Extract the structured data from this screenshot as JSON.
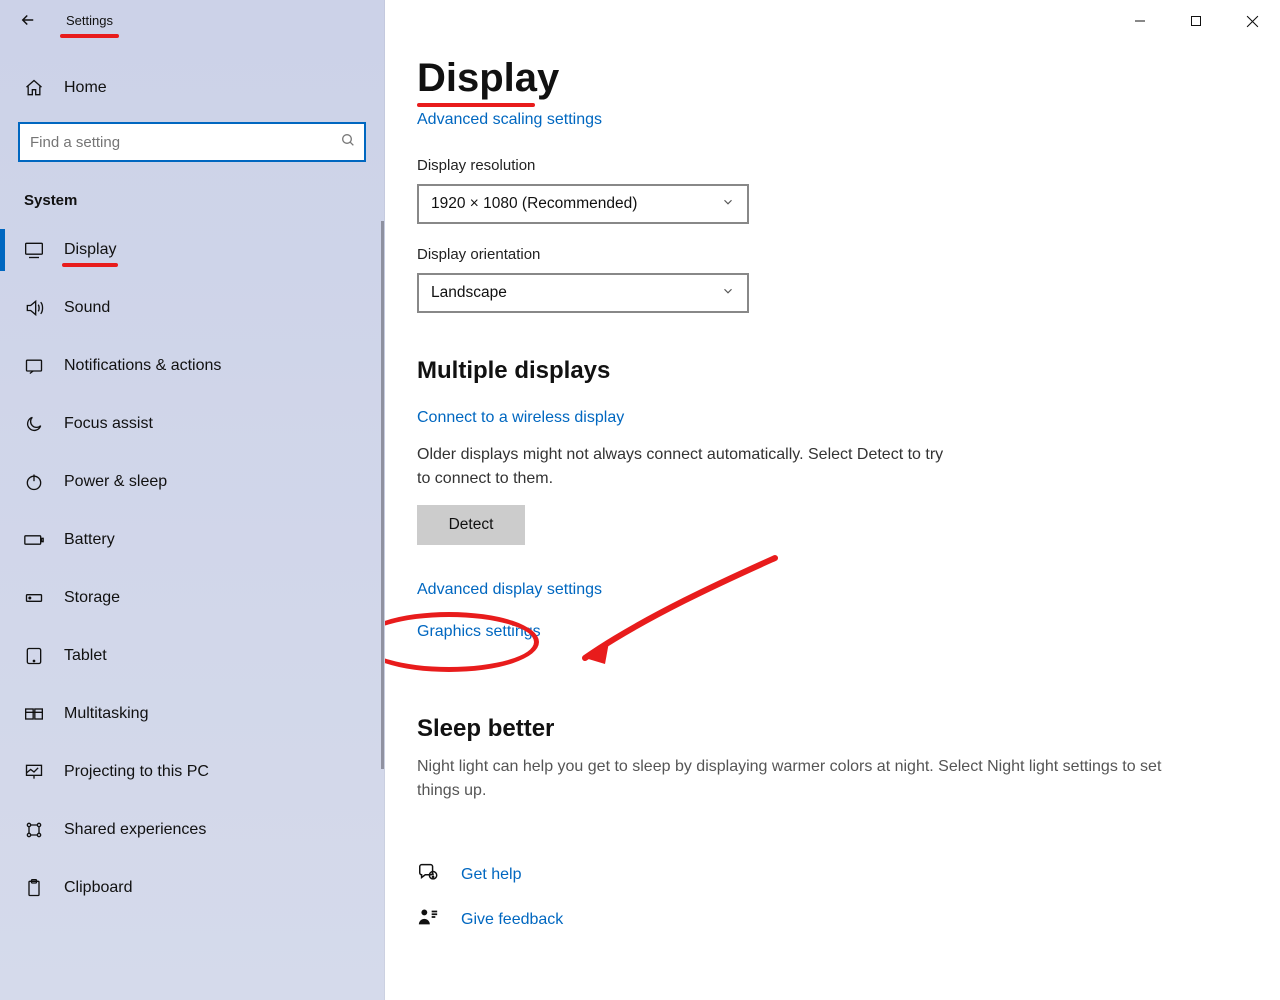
{
  "app_title": "Settings",
  "home_label": "Home",
  "search_placeholder": "Find a setting",
  "section_header": "System",
  "nav_items": [
    {
      "label": "Display",
      "icon": "monitor",
      "active": true
    },
    {
      "label": "Sound",
      "icon": "sound"
    },
    {
      "label": "Notifications & actions",
      "icon": "notifications"
    },
    {
      "label": "Focus assist",
      "icon": "moon"
    },
    {
      "label": "Power & sleep",
      "icon": "power"
    },
    {
      "label": "Battery",
      "icon": "battery"
    },
    {
      "label": "Storage",
      "icon": "storage"
    },
    {
      "label": "Tablet",
      "icon": "tablet"
    },
    {
      "label": "Multitasking",
      "icon": "multitask"
    },
    {
      "label": "Projecting to this PC",
      "icon": "project"
    },
    {
      "label": "Shared experiences",
      "icon": "shared"
    },
    {
      "label": "Clipboard",
      "icon": "clipboard"
    }
  ],
  "page": {
    "title": "Display",
    "advanced_scaling_link": "Advanced scaling settings",
    "resolution_label": "Display resolution",
    "resolution_value": "1920 × 1080 (Recommended)",
    "orientation_label": "Display orientation",
    "orientation_value": "Landscape",
    "multi_header": "Multiple displays",
    "wireless_link": "Connect to a wireless display",
    "detect_text": "Older displays might not always connect automatically. Select Detect to try to connect to them.",
    "detect_button": "Detect",
    "adv_display_link": "Advanced display settings",
    "graphics_link": "Graphics settings",
    "sleep_header": "Sleep better",
    "sleep_text": "Night light can help you get to sleep by displaying warmer colors at night. Select Night light settings to set things up.",
    "help_link": "Get help",
    "feedback_link": "Give feedback"
  },
  "colors": {
    "accent": "#0067c0",
    "annotation": "#e81c1c"
  }
}
